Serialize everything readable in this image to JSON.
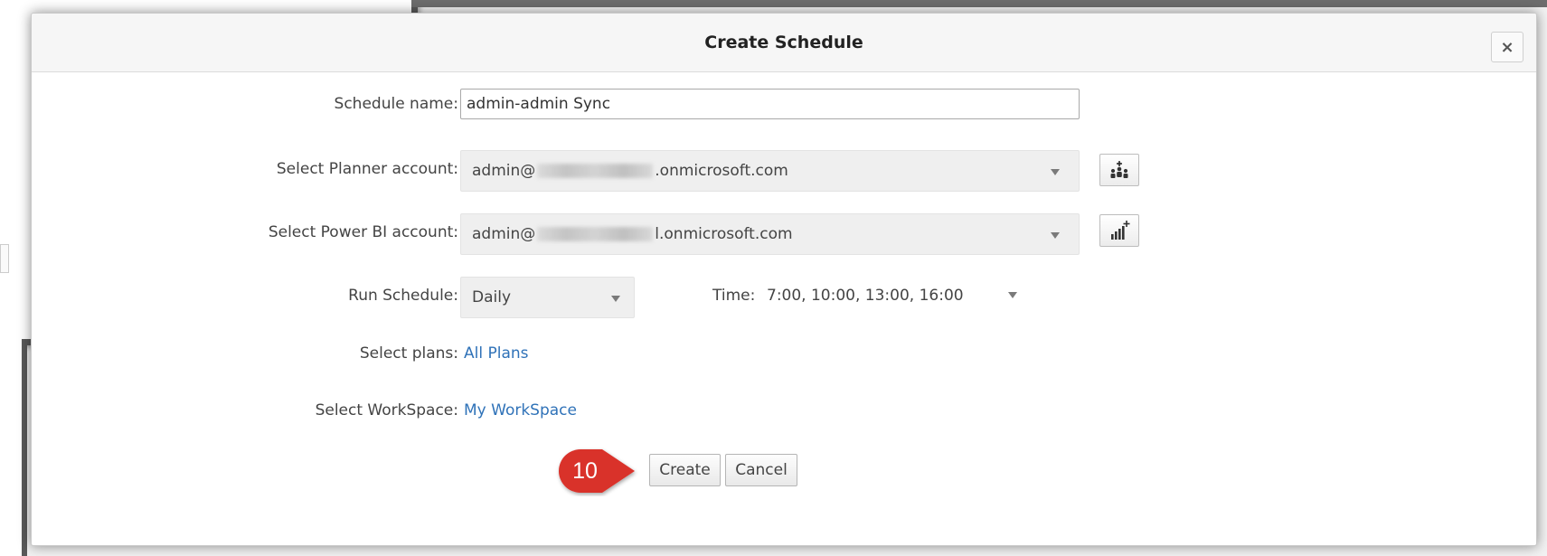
{
  "dialog": {
    "title": "Create Schedule",
    "close_label": "×"
  },
  "form": {
    "schedule_name": {
      "label": "Schedule name:",
      "value": "admin-admin Sync"
    },
    "planner_account": {
      "label": "Select Planner account:",
      "value_prefix": "admin@",
      "value_suffix": ".onmicrosoft.com",
      "action_icon": "people-add-icon"
    },
    "powerbi_account": {
      "label": "Select Power BI account:",
      "value_prefix": "admin@",
      "value_suffix": "l.onmicrosoft.com",
      "action_icon": "bar-chart-add-icon"
    },
    "run_schedule": {
      "label": "Run Schedule:",
      "value": "Daily"
    },
    "time": {
      "label": "Time:",
      "value": "7:00, 10:00, 13:00, 16:00"
    },
    "plans": {
      "label": "Select plans:",
      "value": "All Plans"
    },
    "workspace": {
      "label": "Select WorkSpace:",
      "value": "My WorkSpace"
    }
  },
  "buttons": {
    "create": "Create",
    "cancel": "Cancel"
  },
  "callout": {
    "number": "10",
    "color": "#d9302c"
  },
  "colors": {
    "link": "#2f72b8",
    "header_bg": "#f6f6f6"
  }
}
